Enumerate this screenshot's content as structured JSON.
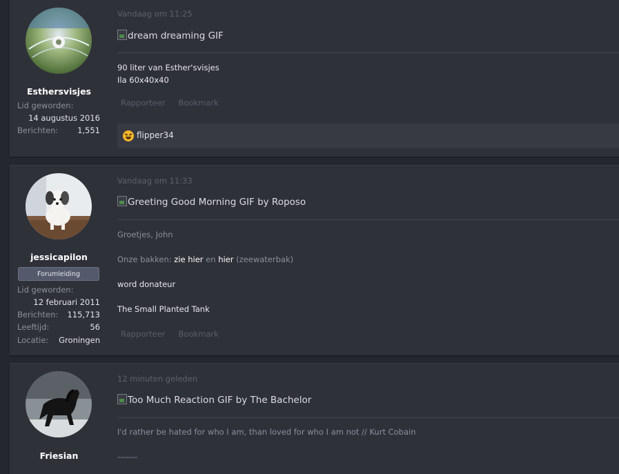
{
  "posts": [
    {
      "user": {
        "username": "Esthersvisjes",
        "stats": [
          {
            "label": "Lid geworden:",
            "value": "14 augustus 2016"
          },
          {
            "label": "Berichten:",
            "value": "1,551"
          }
        ]
      },
      "time": "Vandaag om 11:25",
      "gif_alt": "dream dreaming GIF",
      "signature_lines": [
        "90 liter van Esther'svisjes",
        "Ila 60x40x40"
      ],
      "actions": [
        "Rapporteer",
        "Bookmark"
      ],
      "reaction": {
        "icon": "laughing-emoji-icon",
        "names": "flipper34"
      }
    },
    {
      "user": {
        "username": "jessicapilon",
        "role": "Forumleiding",
        "stats": [
          {
            "label": "Lid geworden:",
            "value": "12 februari 2011"
          },
          {
            "label": "Berichten:",
            "value": "115,713"
          },
          {
            "label": "Leeftijd:",
            "value": "56"
          },
          {
            "label": "Locatie:",
            "value": "Groningen"
          }
        ]
      },
      "time": "Vandaag om 11:33",
      "gif_alt": "Greeting Good Morning GIF by Roposo",
      "signature": {
        "greeting": "Groetjes, John",
        "tanks_label": "Onze bakken:",
        "tank_link1": "zie hier",
        "and": "en",
        "tank_link2": "hier",
        "tank_note": "(zeewaterbak)",
        "donor_link": "word donateur",
        "forum_link": "The Small Planted Tank"
      },
      "actions": [
        "Rapporteer",
        "Bookmark"
      ]
    },
    {
      "user": {
        "username": "Friesian"
      },
      "time": "12 minuten geleden",
      "gif_alt": "Too Much Reaction GIF by The Bachelor",
      "signature": {
        "quote": "I'd rather be hated for who I am, than loved for who I am not // Kurt Cobain",
        "separator": "-------"
      }
    }
  ]
}
